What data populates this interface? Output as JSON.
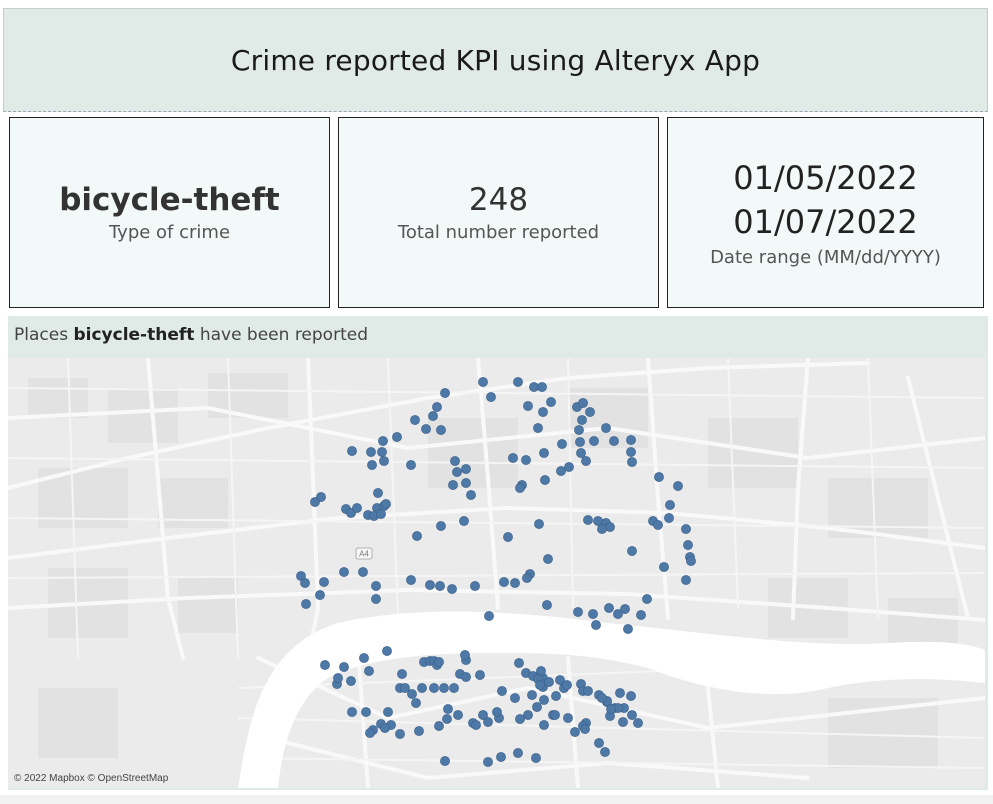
{
  "header": {
    "title": "Crime reported KPI using Alteryx App"
  },
  "kpis": {
    "crime_type": {
      "value": "bicycle-theft",
      "label": "Type of crime"
    },
    "total": {
      "value": "248",
      "label": "Total number reported"
    },
    "date_range": {
      "start": "01/05/2022",
      "end": "01/07/2022",
      "label": "Date range (MM/dd/YYYY)"
    }
  },
  "map": {
    "title_prefix": "Places",
    "title_crime": "bicycle-theft",
    "title_suffix": "have been reported",
    "road_label": "A4",
    "attribution": "© 2022 Mapbox © OpenStreetMap",
    "marker_color": "#4e79a7"
  }
}
